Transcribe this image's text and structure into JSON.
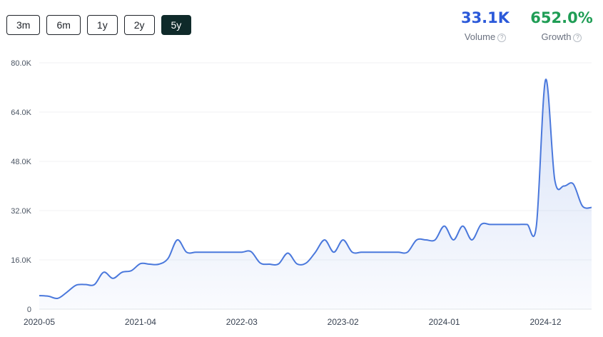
{
  "ranges": {
    "buttons": [
      {
        "label": "3m"
      },
      {
        "label": "6m"
      },
      {
        "label": "1y"
      },
      {
        "label": "2y"
      },
      {
        "label": "5y",
        "active": true
      }
    ]
  },
  "metrics": {
    "volume": {
      "value": "33.1K",
      "label": "Volume",
      "color": "#2b59d9"
    },
    "growth": {
      "value": "652.0%",
      "label": "Growth",
      "color": "#1f9d55"
    }
  },
  "chart_data": {
    "type": "area",
    "title": "",
    "xlabel": "",
    "ylabel": "",
    "ylim": [
      0,
      80000
    ],
    "y_ticks": [
      "0",
      "16.0K",
      "32.0K",
      "48.0K",
      "64.0K",
      "80.0K"
    ],
    "x_tick_labels": [
      "2020-05",
      "2021-04",
      "2022-03",
      "2023-02",
      "2024-01",
      "2024-12"
    ],
    "x_tick_months": [
      0,
      11,
      22,
      33,
      44,
      55
    ],
    "grid": true,
    "line_color": "#4a78dc",
    "series": [
      {
        "x": [
          0,
          1,
          2,
          3,
          4,
          5,
          6,
          7,
          8,
          9,
          10,
          11,
          12,
          13,
          14,
          15,
          16,
          17,
          18,
          19,
          20,
          21,
          22,
          23,
          24,
          25,
          26,
          27,
          28,
          29,
          30,
          31,
          32,
          33,
          34,
          35,
          36,
          37,
          38,
          39,
          40,
          41,
          42,
          43,
          44,
          45,
          46,
          47,
          48,
          49,
          50,
          51,
          52,
          53,
          54,
          55,
          56,
          57,
          58,
          59,
          60
        ],
        "values": [
          4400,
          4200,
          3500,
          5500,
          7800,
          8000,
          8000,
          12000,
          10000,
          12000,
          12500,
          14800,
          14600,
          14600,
          16500,
          22500,
          18500,
          18500,
          18500,
          18500,
          18500,
          18500,
          18500,
          18700,
          15000,
          14600,
          14700,
          18200,
          14700,
          15000,
          18500,
          22500,
          18500,
          22500,
          18500,
          18500,
          18500,
          18500,
          18500,
          18500,
          18500,
          22500,
          22500,
          22500,
          27000,
          22500,
          27000,
          22500,
          27500,
          27500,
          27500,
          27500,
          27500,
          27500,
          27000,
          74500,
          42000,
          40000,
          40700,
          33500,
          33000
        ]
      }
    ]
  }
}
